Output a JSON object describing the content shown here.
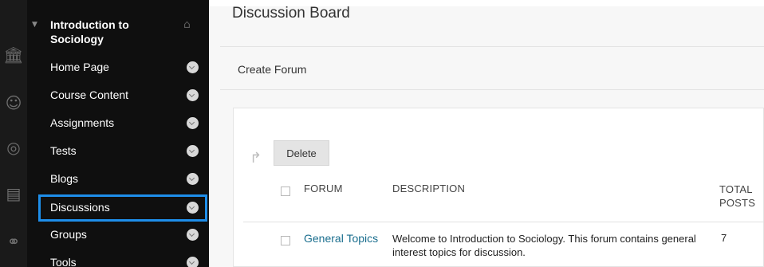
{
  "page": {
    "title": "Discussion Board",
    "create_forum_label": "Create Forum"
  },
  "course_menu": {
    "title": "Introduction to Sociology",
    "items": [
      {
        "label": "Home Page"
      },
      {
        "label": "Course Content"
      },
      {
        "label": "Assignments"
      },
      {
        "label": "Tests"
      },
      {
        "label": "Blogs"
      },
      {
        "label": "Discussions",
        "selected": true
      },
      {
        "label": "Groups"
      },
      {
        "label": "Tools"
      }
    ]
  },
  "toolbar": {
    "delete_label": "Delete"
  },
  "table": {
    "columns": [
      "FORUM",
      "DESCRIPTION",
      "TOTAL POSTS"
    ],
    "rows": [
      {
        "forum": "General Topics",
        "description": "Welcome to Introduction to Sociology. This forum contains general interest topics for discussion.",
        "total_posts": "7"
      }
    ]
  },
  "colors": {
    "accent_focus": "#1e8eea",
    "link": "#1a6e8e",
    "menu_bg": "#0f0f0f"
  },
  "icons": [
    "institution-icon",
    "user-icon",
    "globe-icon",
    "calendar-icon",
    "users-icon",
    "home-icon",
    "chevron-down-icon",
    "return-arrow-icon"
  ]
}
